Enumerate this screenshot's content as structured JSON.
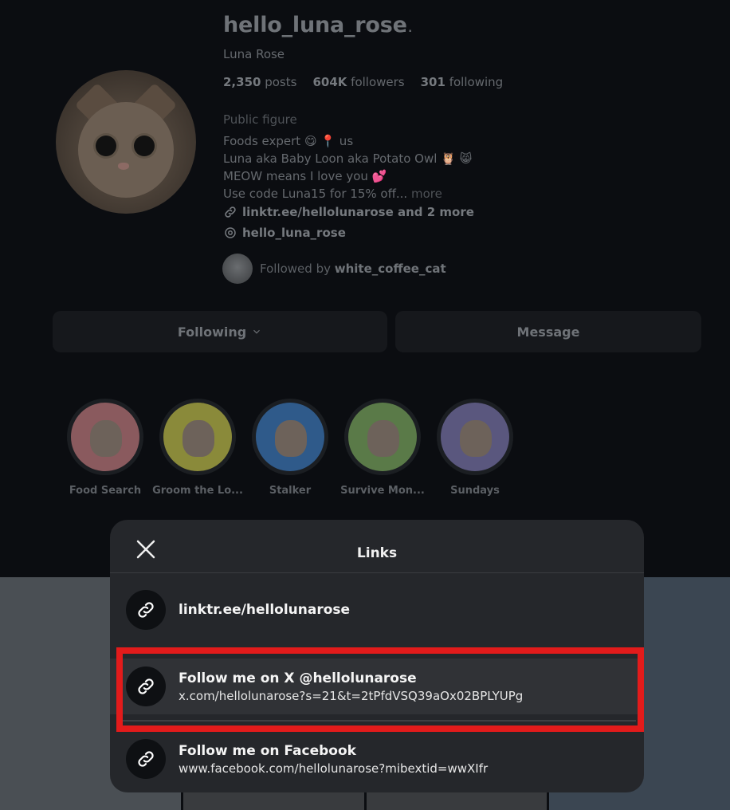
{
  "profile": {
    "username": "hello_luna_rose",
    "more_icon": "…",
    "full_name": "Luna Rose",
    "stats": {
      "posts_value": "2,350",
      "posts_label": "posts",
      "followers_value": "604K",
      "followers_label": "followers",
      "following_value": "301",
      "following_label": "following"
    },
    "category": "Public figure",
    "bio_lines": [
      "Foods expert 😋 📍 us",
      "Luna aka Baby Loon aka Potato Owl 🦉 😸",
      "MEOW means I love you 💕",
      "Use code Luna15 for 15% off..."
    ],
    "bio_more": "more",
    "link_text": "linktr.ee/hellolunarose and 2 more",
    "threads_handle": "hello_luna_rose",
    "followed_by_prefix": "Followed by",
    "followed_by_user": "white_coffee_cat"
  },
  "actions": {
    "following_label": "Following",
    "message_label": "Message"
  },
  "highlights": [
    {
      "label": "Food Search",
      "color": "#8a5a5e"
    },
    {
      "label": "Groom the Lo...",
      "color": "#8a8a3a"
    },
    {
      "label": "Stalker",
      "color": "#2f5a8a"
    },
    {
      "label": "Survive Mon...",
      "color": "#5a7a48"
    },
    {
      "label": "Sundays",
      "color": "#5a577e"
    }
  ],
  "photos": [
    {
      "color": "#4a4f54"
    },
    {
      "color": "#393b3e"
    },
    {
      "color": "#393b3e"
    },
    {
      "color": "#3b4652"
    }
  ],
  "modal": {
    "title": "Links",
    "links": [
      {
        "title": "linktr.ee/hellolunarose",
        "url": ""
      },
      {
        "title": "Follow me on X @hellolunarose",
        "url": "x.com/hellolunarose?s=21&t=2tPfdVSQ39aOx02BPLYUPg"
      },
      {
        "title": "Follow me on Facebook",
        "url": "www.facebook.com/hellolunarose?mibextid=wwXIfr"
      }
    ]
  },
  "colors": {
    "highlight_border": "#e21b1b",
    "modal_bg": "#25272b",
    "page_bg": "#0b0d11"
  }
}
